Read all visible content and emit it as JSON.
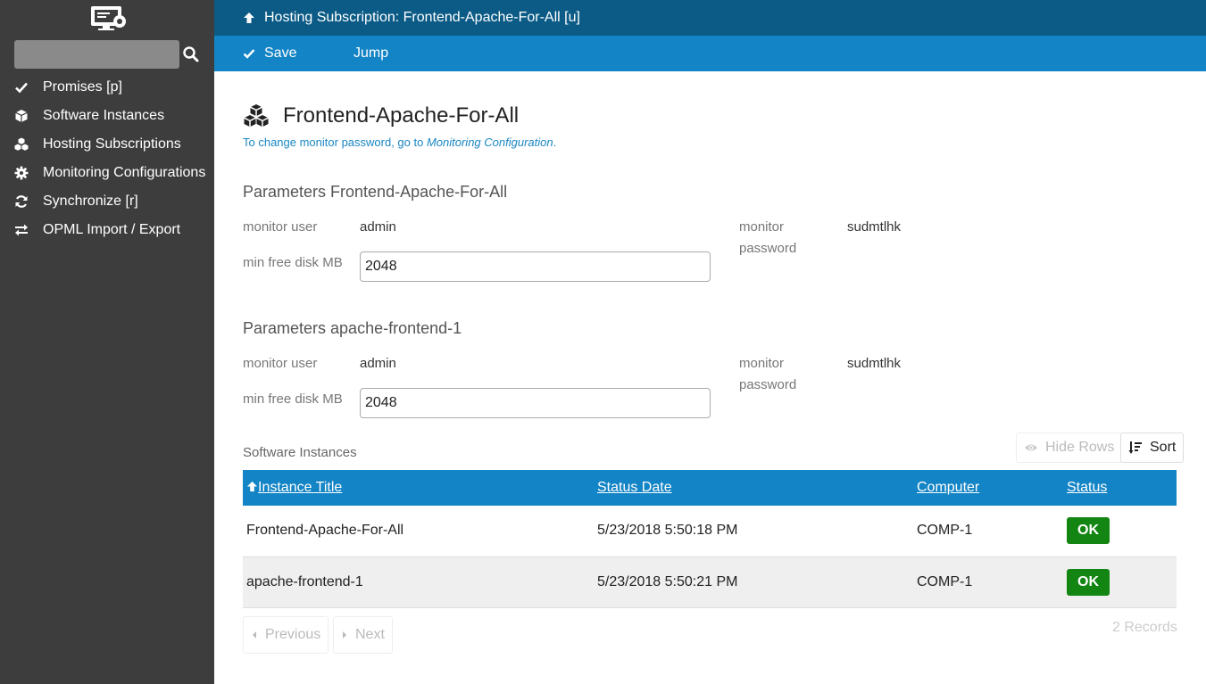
{
  "sidebar": {
    "logo_icon": "monitor-cog-icon",
    "search": {
      "value": "",
      "placeholder": "",
      "icon": "search-icon"
    },
    "items": [
      {
        "label": "Promises [p]",
        "icon": "check-icon"
      },
      {
        "label": "Software Instances",
        "icon": "cube-icon"
      },
      {
        "label": "Hosting Subscriptions",
        "icon": "cubes-icon"
      },
      {
        "label": "Monitoring Configurations",
        "icon": "gear-icon"
      },
      {
        "label": "Synchronize [r]",
        "icon": "refresh-icon"
      },
      {
        "label": "OPML Import / Export",
        "icon": "exchange-icon"
      }
    ]
  },
  "header": {
    "title": "Hosting Subscription: Frontend-Apache-For-All [u]",
    "actions": {
      "save": "Save",
      "jump": "Jump"
    }
  },
  "main": {
    "title": "Frontend-Apache-For-All",
    "hint": {
      "prefix": "To change monitor password, go to ",
      "link": "Monitoring Configuration",
      "suffix": "."
    },
    "parameter_sections": [
      {
        "title": "Parameters Frontend-Apache-For-All",
        "monitor_user_label": "monitor user",
        "monitor_user": "admin",
        "monitor_password_label_1": "monitor",
        "monitor_password_label_2": "password",
        "monitor_password": "sudmtlhk",
        "min_free_disk_label": "min free disk MB",
        "min_free_disk": "2048"
      },
      {
        "title": "Parameters apache-frontend-1",
        "monitor_user_label": "monitor user",
        "monitor_user": "admin",
        "monitor_password_label_1": "monitor",
        "monitor_password_label_2": "password",
        "monitor_password": "sudmtlhk",
        "min_free_disk_label": "min free disk MB",
        "min_free_disk": "2048"
      }
    ],
    "instances": {
      "label": "Software Instances",
      "hide_rows": "Hide Rows",
      "sort": "Sort",
      "columns": [
        "Instance Title",
        "Status Date",
        "Computer",
        "Status"
      ],
      "rows": [
        {
          "title": "Frontend-Apache-For-All",
          "date": "5/23/2018 5:50:18 PM",
          "computer": "COMP-1",
          "status": "OK"
        },
        {
          "title": "apache-frontend-1",
          "date": "5/23/2018 5:50:21 PM",
          "computer": "COMP-1",
          "status": "OK"
        }
      ],
      "previous": "Previous",
      "next": "Next",
      "records": "2 Records"
    }
  },
  "colors": {
    "sidebar_bg": "#3d3d3d",
    "topbar_bg": "#0b5b86",
    "actionbar_bg": "#1384c5",
    "status_ok": "#138513",
    "link": "#1a86c4"
  }
}
